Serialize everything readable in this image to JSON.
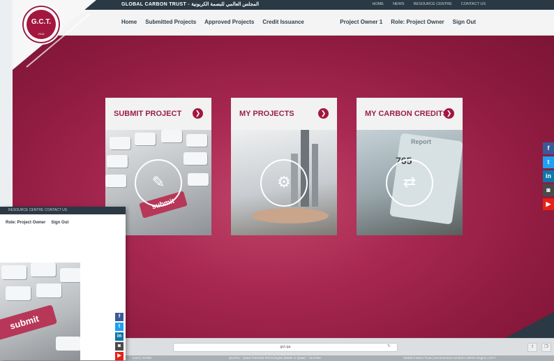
{
  "topbar": {
    "org": "GLOBAL CARBON TRUST - المجلس العالمي للبصمة الكربونية",
    "links": [
      "HOME",
      "NEWS",
      "RESOURCE CENTRE",
      "CONTACT US"
    ]
  },
  "logo": {
    "text": "G.C.T.",
    "year": "2016"
  },
  "nav": {
    "left": [
      "Home",
      "Submitted Projects",
      "Approved Projects",
      "Credit Issuance"
    ],
    "right": [
      "Project Owner 1",
      "Role: Project Owner",
      "Sign Out"
    ]
  },
  "cards": [
    {
      "title": "SUBMIT PROJECT",
      "image_text": "submit"
    },
    {
      "title": "MY PROJECTS"
    },
    {
      "title": "MY CARBON CREDITS",
      "image_text": "Report",
      "image_number": "765"
    }
  ],
  "social": [
    {
      "icon": "facebook-icon",
      "glyph": "f",
      "color": "#3b5998"
    },
    {
      "icon": "twitter-icon",
      "glyph": "t",
      "color": "#1da1f2"
    },
    {
      "icon": "linkedin-icon",
      "glyph": "in",
      "color": "#0e76a8"
    },
    {
      "icon": "instagram-icon",
      "glyph": "◙",
      "color": "#4a4a4a"
    },
    {
      "icon": "youtube-icon",
      "glyph": "▶",
      "color": "#e62117"
    }
  ],
  "browser": {
    "url": "gct.qa",
    "tabs": [
      "ment | GORD",
      "QCOOL - Qatar Potential Technologies (Made in Qatar) - YouTube",
      "Global Carbon Trust | Environment Control in MENA Region | GCT"
    ]
  },
  "overlay": {
    "top_links": [
      "RESOURCE CENTRE",
      "CONTACT US"
    ],
    "nav": [
      "Role: Project Owner",
      "Sign Out"
    ],
    "key_text": "submit"
  },
  "colors": {
    "brand": "#9b1f45",
    "dark": "#2a3944"
  }
}
